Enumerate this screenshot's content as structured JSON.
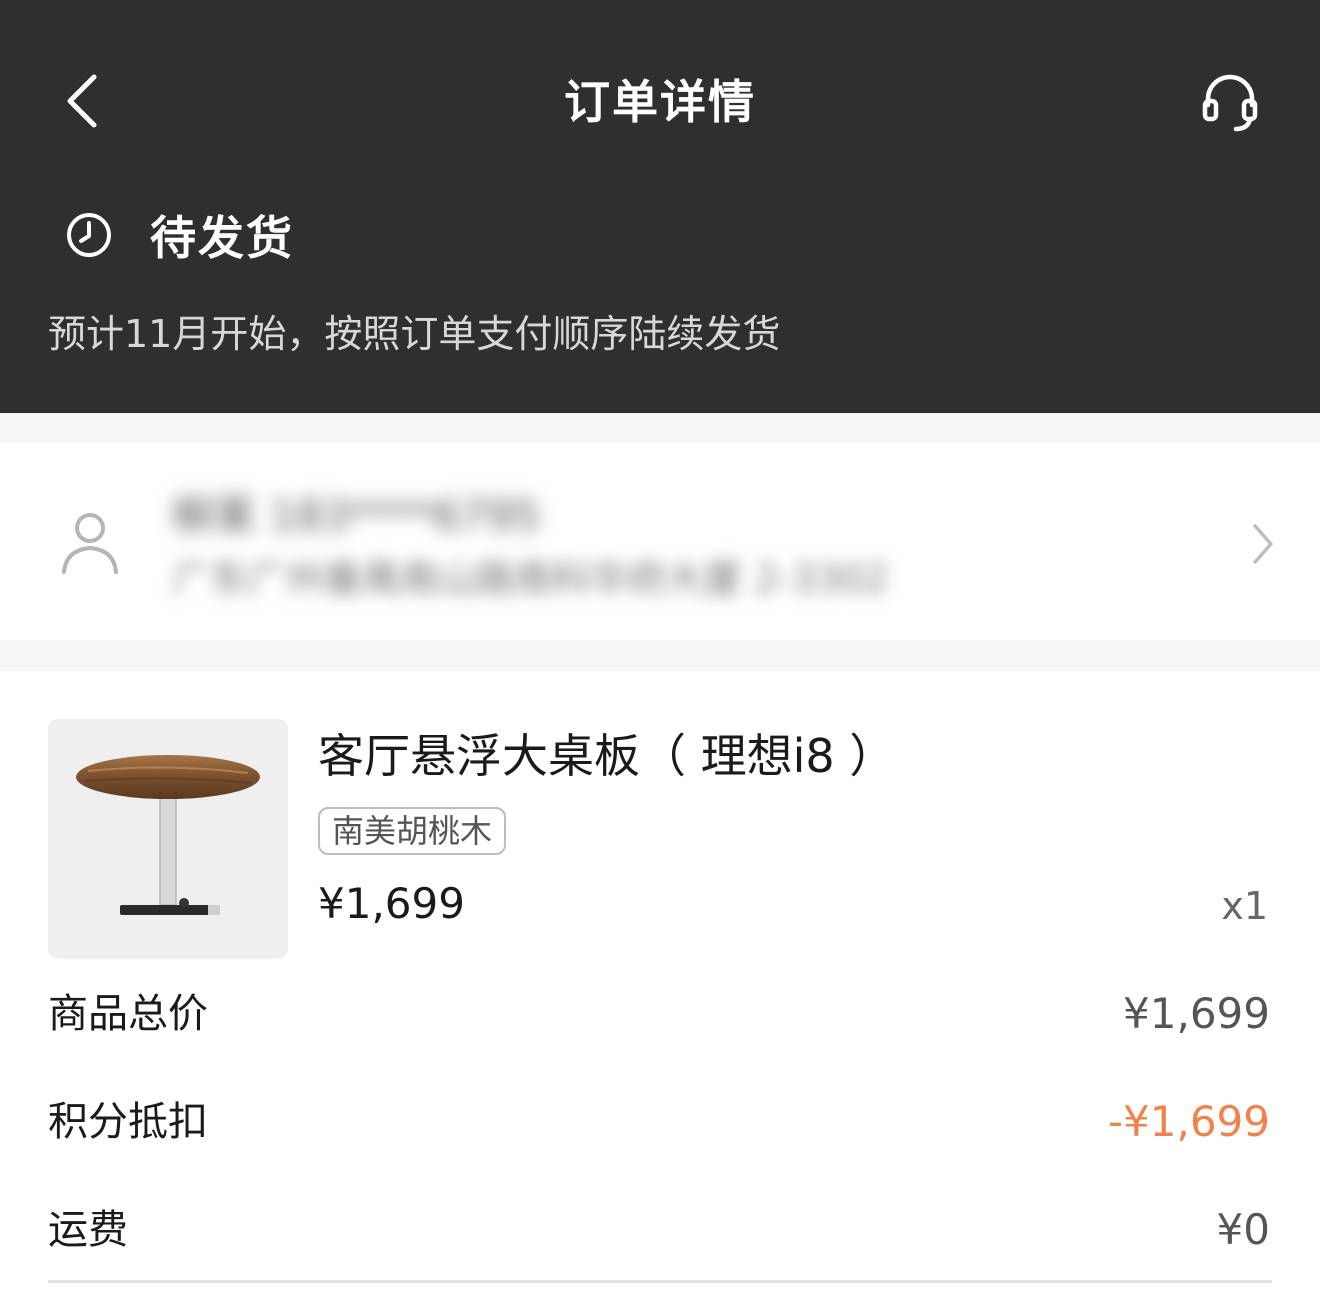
{
  "header": {
    "title": "订单详情",
    "status": "待发货",
    "description": "预计11月开始，按照订单支付顺序陆续发货"
  },
  "address": {
    "name_phone": "柳某 183****6795",
    "address": "广东广州番禺南山路南科华府大厦 2-3302"
  },
  "product": {
    "name": "客厅悬浮大桌板（ 理想i8 ）",
    "variant": "南美胡桃木",
    "price": "¥1,699",
    "quantity": "x1"
  },
  "summary": [
    {
      "label": "商品总价",
      "value": "¥1,699"
    },
    {
      "label": "积分抵扣",
      "value": "-¥1,699"
    },
    {
      "label": "运费",
      "value": "¥0"
    }
  ],
  "colors": {
    "header_bg": "#2f2f2f",
    "discount": "#f0824a"
  },
  "icons": {
    "back": "chevron-left-icon",
    "service": "headset-icon",
    "status": "clock-icon",
    "person": "person-icon",
    "more": "chevron-right-icon"
  }
}
